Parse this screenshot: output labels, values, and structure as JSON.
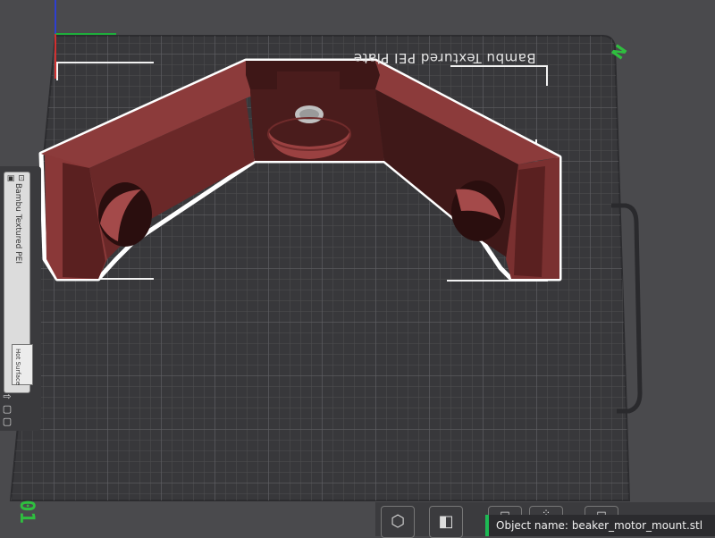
{
  "plate": {
    "label": "Bambu Textured PEI Plate",
    "number": "01",
    "orientation_marker": "N"
  },
  "side_panel": {
    "title": "Bambu Textured PEI",
    "sub_label": "Hot Surface"
  },
  "object_info": {
    "label": "Object name:",
    "name": "beaker_motor_mount.stl"
  },
  "colors": {
    "background": "#4a4a4d",
    "plate": "#3a3a3c",
    "grid": "#58585b",
    "model": "#8a3a3a",
    "model_dark": "#3d1616",
    "accent_green": "#1db954"
  }
}
